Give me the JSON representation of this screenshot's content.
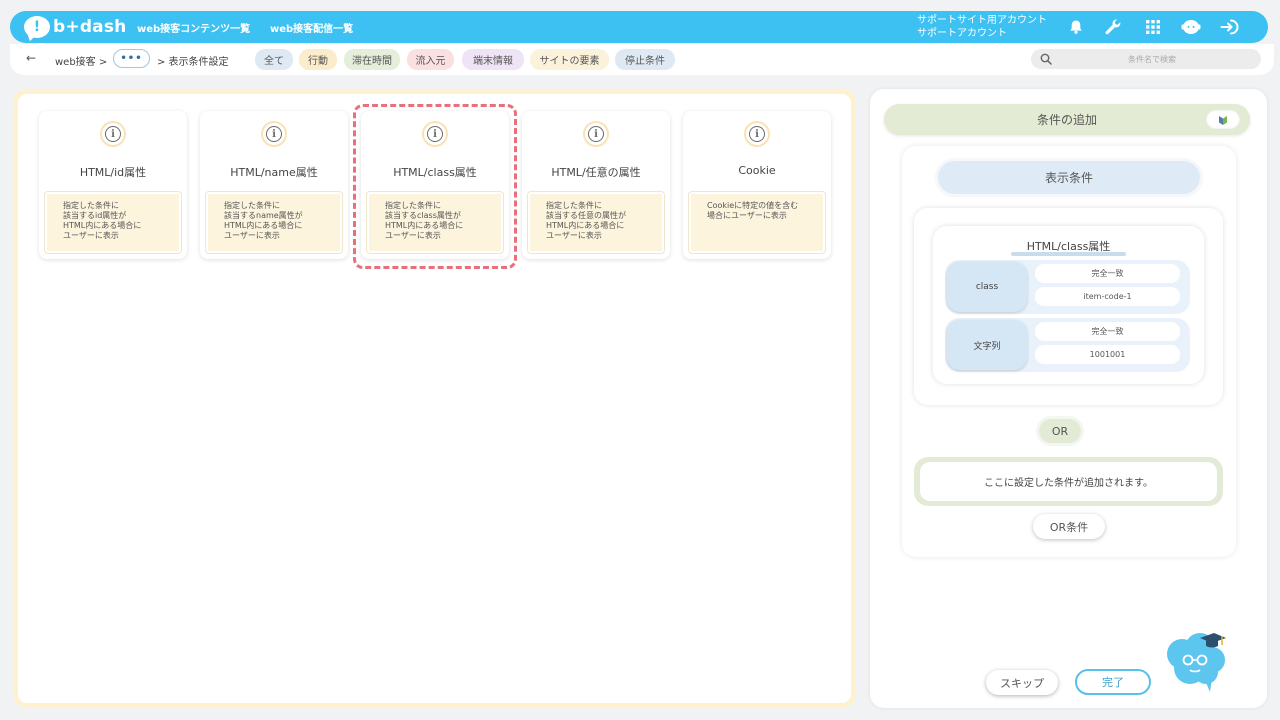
{
  "header": {
    "logo_text": "b+dash",
    "nav": [
      "web接客コンテンツ一覧",
      "web接客配信一覧"
    ],
    "account_line1": "サポートサイト用アカウント",
    "account_line2": "サポートアカウント",
    "icons": [
      "bell-icon",
      "wrench-icon",
      "grid-icon",
      "support-icon",
      "logout-icon"
    ]
  },
  "toolbar": {
    "back": "←",
    "crumb1": "web接客  >",
    "dots": "•••",
    "crumb2": ">  表示条件設定",
    "chips": [
      {
        "label": "全て",
        "color": "#dfe9f3"
      },
      {
        "label": "行動",
        "color": "#fbeccb"
      },
      {
        "label": "滞在時間",
        "color": "#e4eedb"
      },
      {
        "label": "流入元",
        "color": "#fbe0e2"
      },
      {
        "label": "端末情報",
        "color": "#efe4f6"
      },
      {
        "label": "サイトの要素",
        "color": "#fbf2dc"
      },
      {
        "label": "停止条件",
        "color": "#dfe9f3"
      }
    ],
    "search_placeholder": "条件名で検索"
  },
  "cards": [
    {
      "title": "HTML/id属性",
      "desc": "指定した条件に\n該当するid属性が\nHTML内にある場合に\nユーザーに表示"
    },
    {
      "title": "HTML/name属性",
      "desc": "指定した条件に\n該当するname属性が\nHTML内にある場合に\nユーザーに表示"
    },
    {
      "title": "HTML/class属性",
      "desc": "指定した条件に\n該当するclass属性が\nHTML内にある場合に\nユーザーに表示"
    },
    {
      "title": "HTML/任意の属性",
      "desc": "指定した条件に\n該当する任意の属性が\nHTML内にある場合に\nユーザーに表示"
    },
    {
      "title": "Cookie",
      "desc": "Cookieに特定の値を含む\n場合にユーザーに表示"
    }
  ],
  "right": {
    "add_title": "条件の追加",
    "display_condition": "表示条件",
    "condition": {
      "title": "HTML/class属性",
      "rows": [
        {
          "key": "class",
          "match": "完全一致",
          "value": "item-code-1"
        },
        {
          "key": "文字列",
          "match": "完全一致",
          "value": "1001001"
        }
      ]
    },
    "or_label": "OR",
    "added_note": "ここに設定した条件が追加されます。",
    "or_condition_button": "OR条件",
    "skip_button": "スキップ",
    "done_button": "完了"
  }
}
